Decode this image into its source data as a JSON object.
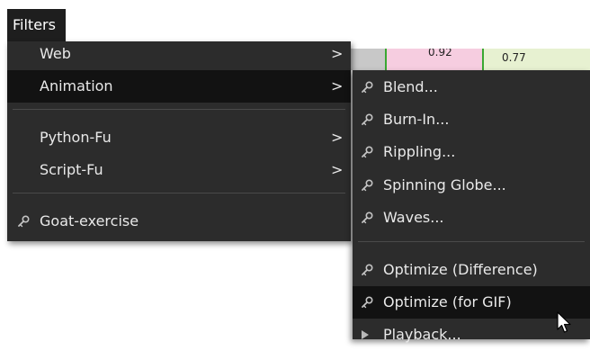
{
  "menubar": {
    "active_label": "Filters"
  },
  "map": {
    "label_1": "0.92",
    "label_2": "0.77"
  },
  "left_menu": {
    "items": [
      {
        "label": "Web",
        "has_submenu": true
      },
      {
        "label": "Animation",
        "has_submenu": true,
        "active": true
      },
      {
        "label": "Python-Fu",
        "has_submenu": true
      },
      {
        "label": "Script-Fu",
        "has_submenu": true
      },
      {
        "label": "Goat-exercise",
        "has_submenu": false,
        "icon": "plugin-icon"
      }
    ],
    "submenu_arrow": ">"
  },
  "animation_submenu": {
    "items": [
      {
        "label": "Blend...",
        "icon": "plugin-icon"
      },
      {
        "label": "Burn-In...",
        "icon": "plugin-icon"
      },
      {
        "label": "Rippling...",
        "icon": "plugin-icon"
      },
      {
        "label": "Spinning Globe...",
        "icon": "plugin-icon"
      },
      {
        "label": "Waves...",
        "icon": "plugin-icon"
      },
      {
        "label": "Optimize (Difference)",
        "icon": "plugin-icon"
      },
      {
        "label": "Optimize (for GIF)",
        "icon": "plugin-icon",
        "active": true
      },
      {
        "label": "Playback...",
        "icon": "play-icon"
      }
    ]
  },
  "colors": {
    "menu_bg": "#2c2c2c",
    "menu_active_bg": "#121212",
    "menu_text": "#e9e9e9",
    "separator": "#4a4a4a"
  }
}
